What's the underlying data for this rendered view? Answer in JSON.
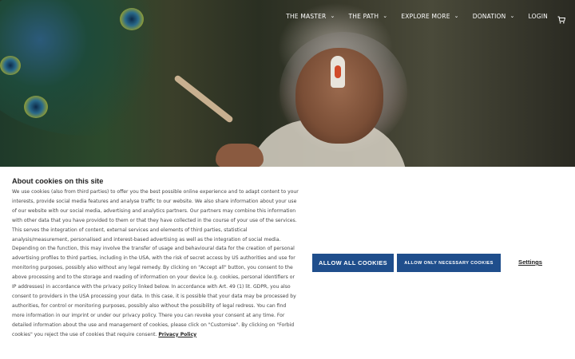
{
  "nav": {
    "items": [
      {
        "label": "THE MASTER",
        "has_dropdown": true
      },
      {
        "label": "THE PATH",
        "has_dropdown": true
      },
      {
        "label": "EXPLORE MORE",
        "has_dropdown": true
      },
      {
        "label": "DONATION",
        "has_dropdown": true
      },
      {
        "label": "LOGIN",
        "has_dropdown": false
      }
    ],
    "cart_icon": "cart-icon"
  },
  "cookie": {
    "title": "About cookies on this site",
    "body": "We use cookies (also from third parties) to offer you the best possible online experience and to adapt content to your interests, provide social media features and analyse traffic to our website. We also share information about your use of our website with our social media, advertising and analytics partners. Our partners may combine this information with other data that you have provided to them or that they have collected in the course of your use of the services. This serves the integration of content, external services and elements of third parties, statistical analysis/measurement, personalised and interest-based advertising as well as the integration of social media. Depending on the function, this may involve the transfer of usage and behavioural data for the creation of personal advertising profiles to third parties, including in the USA, with the risk of secret access by US authorities and use for monitoring purposes, possibly also without any legal remedy. By clicking on \"Accept all\" button, you consent to the above processing and to the storage and reading of information on your device (e.g. cookies, personal identifiers or IP addresses) in accordance with the privacy policy linked below. In accordance with Art. 49 (1) lit. GDPR, you also consent to providers in the USA processing your data. In this case, it is possible that your data may be processed by authorities, for control or monitoring purposes, possibly also without the possibility of legal redress. You can find more information in our imprint or under our privacy policy. There you can revoke your consent at any time. For detailed information about the use and management of cookies, please click on \"Customise\". By clicking on \"Forbid cookies\" you reject the use of cookies that require consent.",
    "privacy_link": "Privacy Policy",
    "allow_all": "ALLOW ALL COOKIES",
    "allow_necessary": "ALLOW ONLY NECESSARY COOKIES",
    "settings": "Settings"
  },
  "colors": {
    "button_bg": "#1f4e8c",
    "nav_text": "#ffffff"
  }
}
